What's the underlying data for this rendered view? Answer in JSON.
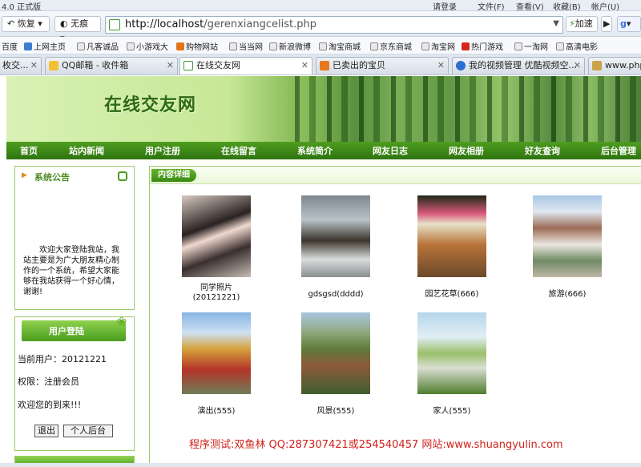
{
  "browser": {
    "title": "4.0 正式版",
    "menu": [
      "请登录",
      "文件(F)",
      "查看(V)",
      "收藏(B)",
      "帐户(U)"
    ],
    "back_label": "恢复",
    "mode_label": "无痕",
    "url_host": "http://localhost",
    "url_path": "/gerenxiangcelist.php",
    "speed_label": "加速",
    "bookmarks": [
      "百度",
      "上网主页",
      "凡客诚品",
      "小游戏大",
      "购物网站",
      "当当网",
      "新浪微博",
      "淘宝商城",
      "京东商城",
      "淘宝网",
      "热门游戏",
      "一淘网",
      "高清电影"
    ],
    "tabs": [
      "枚交...",
      "QQ邮箱 - 收件箱",
      "在线交友网",
      "已卖出的宝贝",
      "我的视频管理 优酷视频空...",
      "www.php"
    ]
  },
  "site": {
    "logo": "在线交友网",
    "nav": [
      "首页",
      "站内新闻",
      "用户注册",
      "在线留言",
      "系统简介",
      "网友日志",
      "网友相册",
      "好友查询",
      "后台管理"
    ]
  },
  "notice": {
    "title": "系统公告",
    "text": "欢迎大家登陆我站，我站主要是为广大朋友精心制作的一个系统，希望大家能够在我站获得一个好心情，谢谢!"
  },
  "login": {
    "title": "用户登陆",
    "current_user": "当前用户：20121221",
    "role": "权限：注册会员",
    "welcome": "欢迎您的到来!!!",
    "logout_label": "退出",
    "admin_label": "个人后台"
  },
  "content": {
    "title": "内容详细",
    "albums": [
      {
        "caption": "同学照片",
        "sub": "(20121221)"
      },
      {
        "caption": "gdsgsd(dddd)",
        "sub": ""
      },
      {
        "caption": "园艺花草(666)",
        "sub": ""
      },
      {
        "caption": "旅游(666)",
        "sub": ""
      },
      {
        "caption": "演出(555)",
        "sub": ""
      },
      {
        "caption": "风景(555)",
        "sub": ""
      },
      {
        "caption": "家人(555)",
        "sub": ""
      }
    ],
    "footer": "程序测试:双鱼林 QQ:287307421或254540457 网站:www.shuangyulin.com"
  },
  "colors": {
    "nav_green": "#3f8a18",
    "accent_green": "#4b8a1e",
    "footer_red": "#d0201a"
  }
}
